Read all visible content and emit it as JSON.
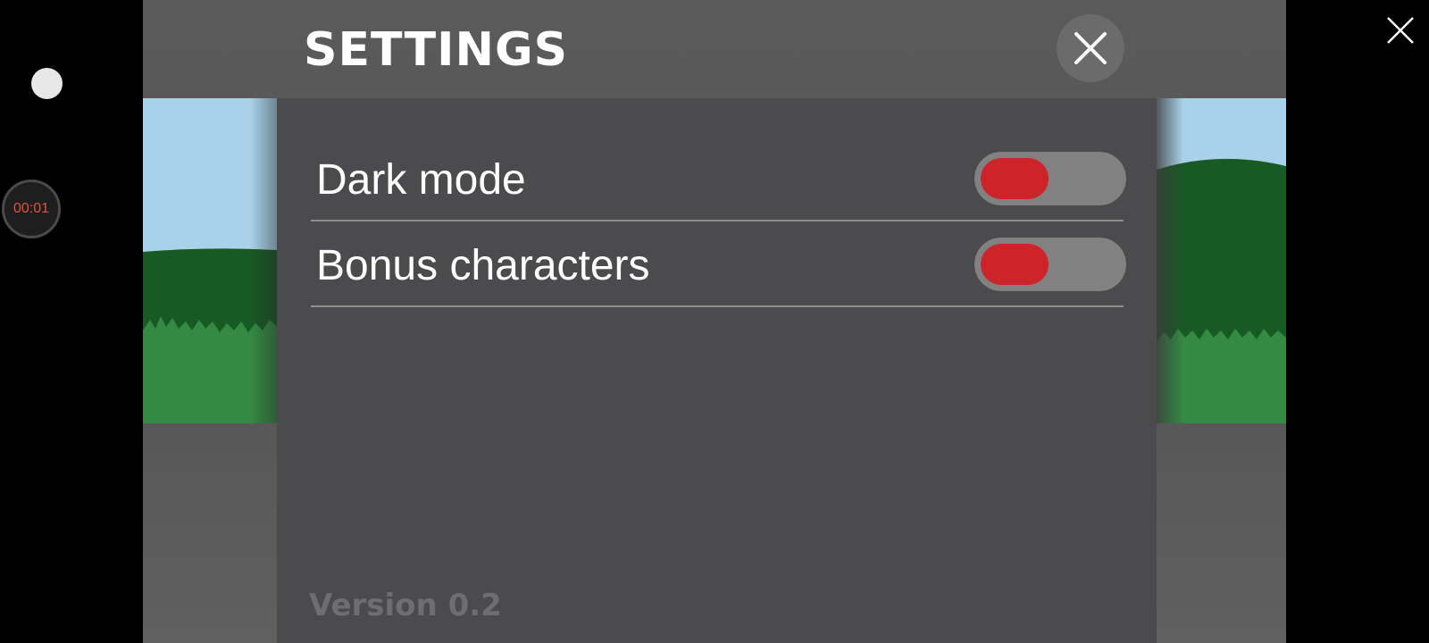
{
  "recorder": {
    "timer": "00:01"
  },
  "header": {
    "title": "SETTINGS",
    "close_icon": "close-icon"
  },
  "settings": [
    {
      "label": "Dark mode",
      "enabled": false
    },
    {
      "label": "Bonus characters",
      "enabled": false
    }
  ],
  "footer": {
    "version": "Version 0.2"
  },
  "colors": {
    "toggle_knob": "#cc2428",
    "toggle_track": "#828182",
    "panel_bg": "#4b4a4c",
    "timer_text": "#e0523d"
  }
}
